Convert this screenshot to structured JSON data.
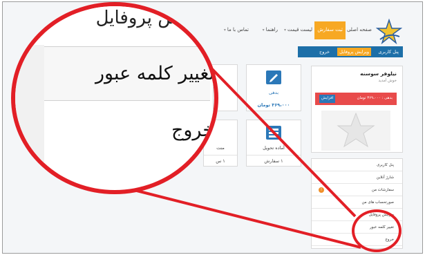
{
  "nav": {
    "items": [
      "صفحه اصلی",
      "ثبت سفارش",
      "لیست قیمت",
      "راهنما",
      "تماس با ما"
    ],
    "active_index": 1
  },
  "tabs": {
    "items": [
      "پنل کاربری",
      "ویرایش پروفایل",
      "خروج"
    ]
  },
  "profile": {
    "name": "نیلوفر سوسنه",
    "welcome": "خوش آمدید",
    "wallet_text": "بدهی : ۳۶۹،۰۰۰ تومان",
    "wallet_button": "افزایش"
  },
  "cards": {
    "debt": {
      "label": "بدهی",
      "value": "۳۶۹،۰۰۰ تومان"
    },
    "ready": {
      "label": "آماده تحویل",
      "value": "۱ سفارش"
    },
    "partial": {
      "label": "منت",
      "value": "۱ س"
    }
  },
  "sidemenu": {
    "items": [
      "پنل کاربری",
      "شارژ آنلاین",
      "سفارشات من",
      "صورتحساب های من",
      "ویرایش پروفایل",
      "تغییر کلمه عبور",
      "خروج"
    ],
    "badge": "!"
  },
  "magnifier": {
    "top_text": "ویرایش پروفایل",
    "row1": "تغییر کلمه عبور",
    "row2": "خروج"
  },
  "colors": {
    "accent_orange": "#f7a823",
    "nav_blue": "#1d6fa8",
    "highlight_red": "#e21f26",
    "wallet_red": "#e84b4b"
  }
}
